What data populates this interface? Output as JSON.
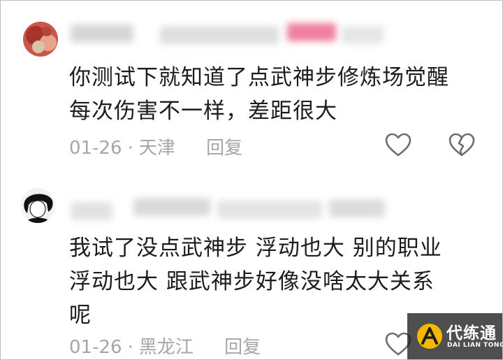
{
  "comments": [
    {
      "text_lines": [
        "你测试下就知道了点武神步修炼场觉醒",
        "每次伤害不一样，差距很大"
      ],
      "date": "01-26",
      "separator": "·",
      "location": "天津",
      "reply_label": "回复",
      "icons": [
        "like-heart-icon",
        "dislike-broken-heart-icon"
      ]
    },
    {
      "text_lines": [
        "我试了没点武神步 浮动也大 别的职业",
        "浮动也大 跟武神步好像没啥太大关系",
        "呢"
      ],
      "date": "01-26",
      "separator": "·",
      "location": "黑龙江",
      "reply_label": "回复",
      "icons": [
        "like-heart-icon"
      ]
    }
  ],
  "watermark": {
    "title": "代练通",
    "subtitle": "DAI LIAN TONG"
  },
  "colors": {
    "text": "#1c1c1c",
    "meta": "#a6a6a6",
    "blur_pink": "#ef7fa0",
    "watermark_bg": "#1e1e1e",
    "logo_yellow": "#f5b800"
  }
}
